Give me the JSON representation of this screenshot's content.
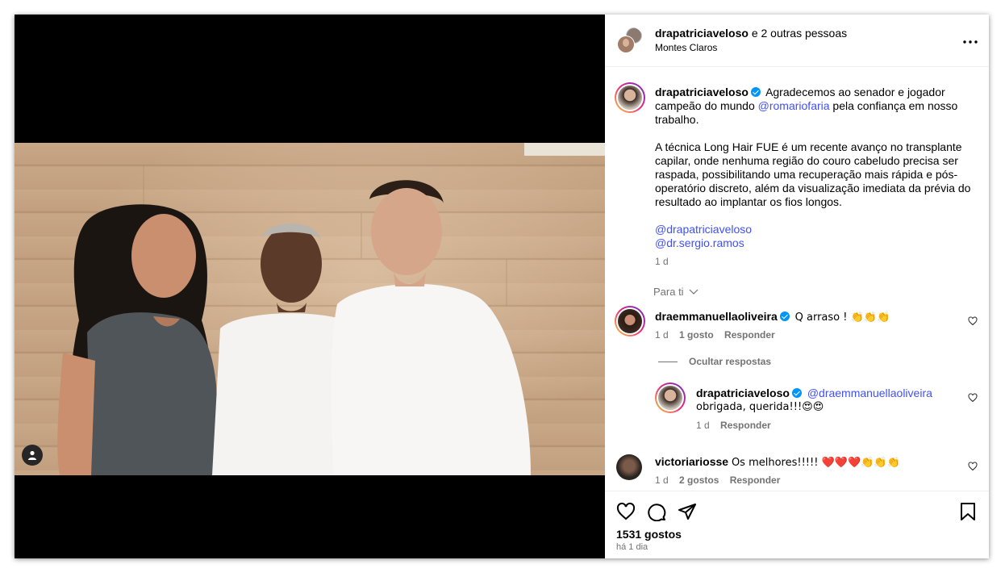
{
  "post": {
    "header": {
      "title_user": "drapatriciaveloso",
      "title_rest": " e 2 outras pessoas",
      "location": "Montes Claros"
    },
    "caption": {
      "user": "drapatriciaveloso",
      "p1_a": "Agradecemos ao senador e jogador campeão do mundo ",
      "p1_mention": "@romariofaria",
      "p1_b": " pela confiança em nosso trabalho.",
      "p2": "A técnica Long Hair FUE é um recente avanço no transplante capilar, onde nenhuma região do couro cabeludo precisa ser raspada, possibilitando uma recuperação mais rápida e pós-operatório discreto, além da visualização imediata da prévia do resultado ao implantar os fios longos.",
      "mention1": "@drapatriciaveloso",
      "mention2": "@dr.sergio.ramos",
      "time": "1 d"
    },
    "filter": {
      "label": "Para ti"
    },
    "comments": [
      {
        "user": "draemmanuellaoliveira",
        "text": "Q arraso ! 👏👏👏",
        "time": "1 d",
        "likes": "1 gosto",
        "reply": "Responder",
        "hide_replies": "Ocultar respostas"
      },
      {
        "user": "drapatriciaveloso",
        "mention": "@draemmanuellaoliveira",
        "text": "obrigada, querida!!!😍😍",
        "time": "1 d",
        "reply": "Responder"
      },
      {
        "user": "victoriariosse",
        "text": "Os melhores!!!!! ❤️❤️❤️👏👏👏",
        "time": "1 d",
        "likes": "2 gostos",
        "reply": "Responder"
      }
    ],
    "likes": "1531 gostos",
    "posted": "há 1 dia",
    "icons": {
      "more": "more-icon",
      "like": "heart-icon",
      "comment": "comment-icon",
      "share": "share-icon",
      "save": "bookmark-icon",
      "tag": "user-tag-icon"
    }
  }
}
